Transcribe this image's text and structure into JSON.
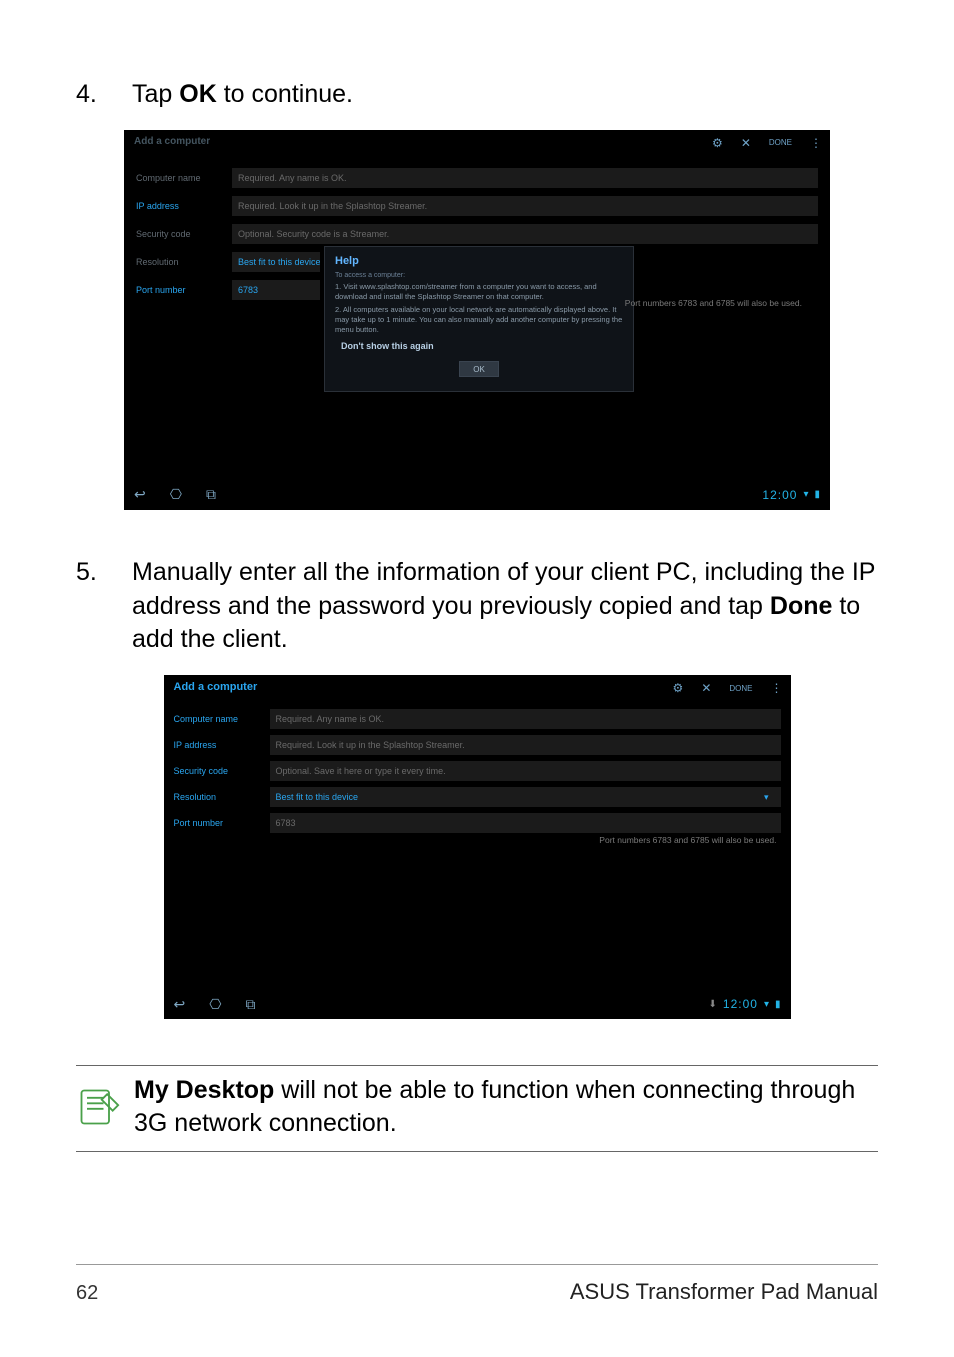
{
  "step4": {
    "num": "4.",
    "text_before": "Tap ",
    "bold": "OK",
    "text_after": " to continue."
  },
  "step5": {
    "num": "5.",
    "text_before": "Manually enter all the information of your client PC, including the IP address and the password you previously copied and tap ",
    "bold": "Done",
    "text_after": " to add the client."
  },
  "shot1": {
    "title": "Add a computer",
    "rows": [
      {
        "label": "Computer name",
        "label_style": "muted",
        "value": "Required. Any name is OK."
      },
      {
        "label": "IP address",
        "label_style": "blue",
        "value": "Required. Look it up in the Splashtop Streamer."
      },
      {
        "label": "Security code",
        "label_style": "muted",
        "value": "Optional. Security code is a Streamer."
      },
      {
        "label": "Resolution",
        "label_style": "muted",
        "value": "Best fit to this device"
      },
      {
        "label": "Port number",
        "label_style": "blue",
        "value": "6783"
      }
    ],
    "modal": {
      "title": "Help",
      "sub": "To access a computer:",
      "lines": [
        "1. Visit www.splashtop.com/streamer from a computer you want to access, and download and install the Splashtop Streamer on that computer.",
        "2. All computers available on your local network are automatically displayed above. It may take up to 1 minute. You can also manually add another computer by pressing the menu button."
      ],
      "dont": "Don't show this again",
      "ok": "OK"
    },
    "port_hint": "Port numbers 6783 and 6785 will also be used.",
    "clock": "12:00",
    "top_icons": {
      "settings": "settings-icon",
      "close": "close-icon",
      "done": "done-label",
      "done_text": "DONE",
      "menu": "menu-icon"
    }
  },
  "shot2": {
    "title": "Add a computer",
    "rows": [
      {
        "label": "Computer name",
        "label_style": "blue",
        "value": "Required. Any name is OK."
      },
      {
        "label": "IP address",
        "label_style": "blue",
        "value": "Required. Look it up in the Splashtop Streamer."
      },
      {
        "label": "Security code",
        "label_style": "blue",
        "value": "Optional. Save it here or type it every time."
      },
      {
        "label": "Resolution",
        "label_style": "blue",
        "value": "Best fit to this device"
      },
      {
        "label": "Port number",
        "label_style": "blue",
        "value": "6783"
      }
    ],
    "port_hint": "Port numbers 6783 and 6785 will also be used.",
    "clock": "12:00"
  },
  "note": {
    "bold": "My Desktop",
    "text": " will not be able to function when connecting through 3G network connection."
  },
  "footer": {
    "page": "62",
    "manual": "ASUS Transformer Pad Manual"
  }
}
